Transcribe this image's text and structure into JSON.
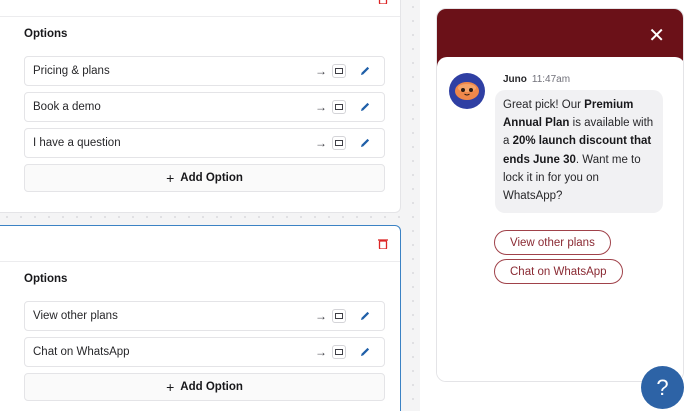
{
  "editor": {
    "cards": [
      {
        "options_label": "Options",
        "options": [
          {
            "label": "Pricing & plans"
          },
          {
            "label": "Book a demo"
          },
          {
            "label": "I have a question"
          }
        ],
        "add_option_label": "Add Option"
      },
      {
        "options_label": "Options",
        "options": [
          {
            "label": "View other plans"
          },
          {
            "label": "Chat on WhatsApp"
          }
        ],
        "add_option_label": "Add Option"
      }
    ],
    "arrow_glyph": "→",
    "plus_glyph": "+"
  },
  "chat": {
    "close_glyph": "✕",
    "sender": "Juno",
    "time": "11:47am",
    "message": {
      "part1": "Great pick! Our ",
      "bold1": "Premium Annual Plan",
      "part2": " is available with a ",
      "bold2": "20% launch discount that ends June 30",
      "part3": ". Want me to lock it in for you on WhatsApp?"
    },
    "chips": [
      {
        "label": "View other plans"
      },
      {
        "label": "Chat on WhatsApp"
      }
    ],
    "header_color": "#6b1118",
    "avatar_color": "#2f3fa3"
  },
  "help": {
    "glyph": "?",
    "color": "#2d63a6"
  }
}
